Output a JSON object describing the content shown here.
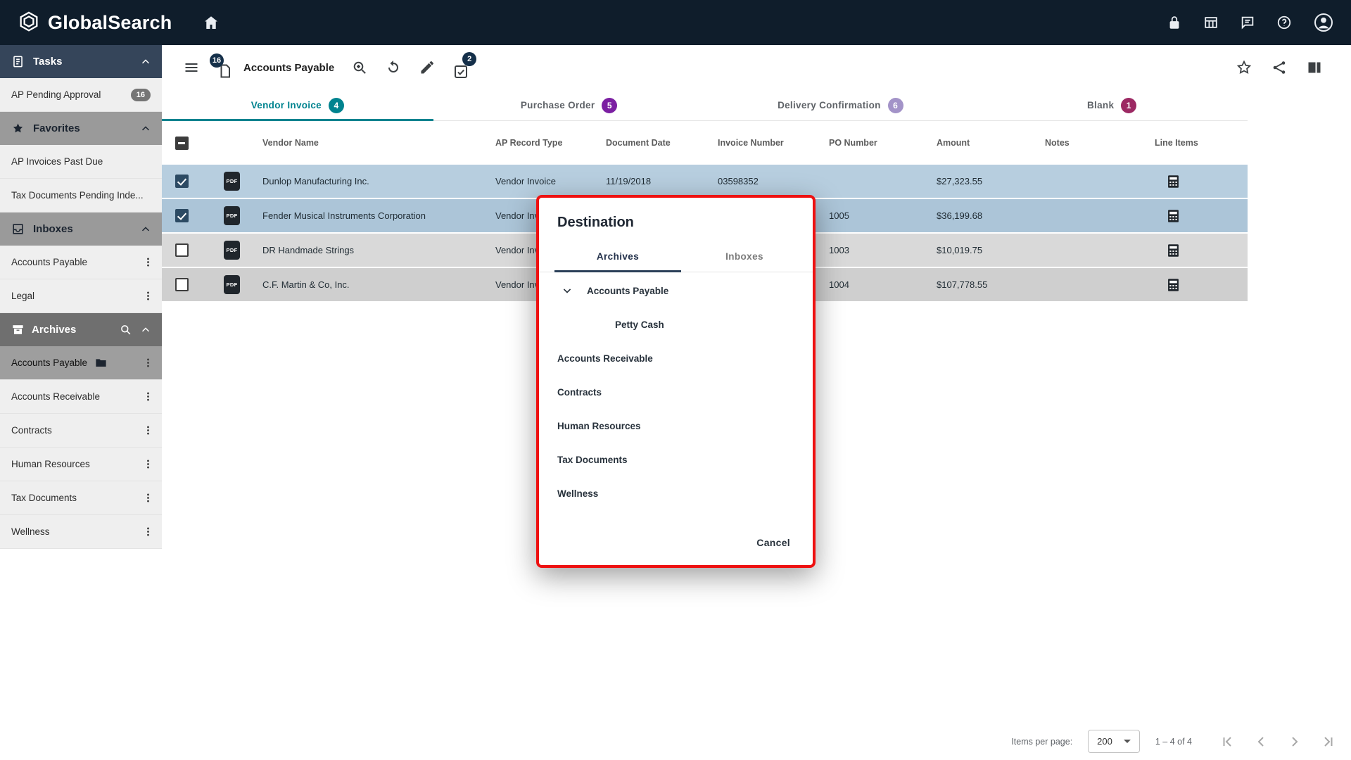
{
  "colors": {
    "topbar_bg": "#0f1d2b",
    "accent_teal": "#00838f",
    "badge_purple": "#7b1fa2",
    "badge_lavender": "#a393c8",
    "badge_berry": "#9c2963",
    "badge_navy": "#15304a",
    "selected_row_blue": "#b7cedf",
    "dialog_highlight_red": "#ee1111"
  },
  "topbar": {
    "brand": "GlobalSearch"
  },
  "sidebar": {
    "tasks": {
      "label": "Tasks",
      "items": [
        {
          "label": "AP Pending Approval",
          "badge": "16"
        }
      ]
    },
    "favorites": {
      "label": "Favorites",
      "items": [
        {
          "label": "AP Invoices Past Due"
        },
        {
          "label": "Tax Documents Pending Inde..."
        }
      ]
    },
    "inboxes": {
      "label": "Inboxes",
      "items": [
        {
          "label": "Accounts Payable"
        },
        {
          "label": "Legal"
        }
      ]
    },
    "archives": {
      "label": "Archives",
      "items": [
        {
          "label": "Accounts Payable",
          "selected": true
        },
        {
          "label": "Accounts Receivable"
        },
        {
          "label": "Contracts"
        },
        {
          "label": "Human Resources"
        },
        {
          "label": "Tax Documents"
        },
        {
          "label": "Wellness"
        }
      ]
    }
  },
  "toolbar": {
    "title": "Accounts Payable",
    "doc_badge": "16",
    "task_badge": "2"
  },
  "tabs": [
    {
      "label": "Vendor Invoice",
      "badge": "4",
      "active": true
    },
    {
      "label": "Purchase Order",
      "badge": "5"
    },
    {
      "label": "Delivery Confirmation",
      "badge": "6"
    },
    {
      "label": "Blank",
      "badge": "1"
    }
  ],
  "table": {
    "headers": {
      "vendor": "Vendor Name",
      "type": "AP Record Type",
      "date": "Document Date",
      "invoice": "Invoice Number",
      "po": "PO Number",
      "amount": "Amount",
      "notes": "Notes",
      "line_items": "Line Items"
    },
    "rows": [
      {
        "checked": true,
        "vendor": "Dunlop Manufacturing Inc.",
        "type": "Vendor Invoice",
        "date": "11/19/2018",
        "invoice": "03598352",
        "po": "",
        "amount": "$27,323.55",
        "notes": ""
      },
      {
        "checked": true,
        "vendor": "Fender Musical Instruments Corporation",
        "type": "Vendor Invoice",
        "date": "",
        "invoice": "",
        "po": "1005",
        "amount": "$36,199.68",
        "notes": ""
      },
      {
        "checked": false,
        "vendor": "DR Handmade Strings",
        "type": "Vendor Invoice",
        "date": "",
        "invoice": "",
        "po": "1003",
        "amount": "$10,019.75",
        "notes": ""
      },
      {
        "checked": false,
        "vendor": "C.F. Martin & Co, Inc.",
        "type": "Vendor Invoice",
        "date": "",
        "invoice": "",
        "po": "1004",
        "amount": "$107,778.55",
        "notes": ""
      }
    ]
  },
  "dialog": {
    "title": "Destination",
    "tabs": [
      {
        "label": "Archives",
        "active": true
      },
      {
        "label": "Inboxes"
      }
    ],
    "tree": [
      {
        "label": "Accounts Payable",
        "expanded": true
      },
      {
        "label": "Petty Cash",
        "child_of": "Accounts Payable"
      },
      {
        "label": "Accounts Receivable"
      },
      {
        "label": "Contracts"
      },
      {
        "label": "Human Resources"
      },
      {
        "label": "Tax Documents"
      },
      {
        "label": "Wellness"
      }
    ],
    "cancel_label": "Cancel"
  },
  "pagination": {
    "items_per_page_label": "Items per page:",
    "items_per_page_value": "200",
    "range": "1 – 4 of 4"
  },
  "icons": {
    "pdf_label": "PDF"
  }
}
